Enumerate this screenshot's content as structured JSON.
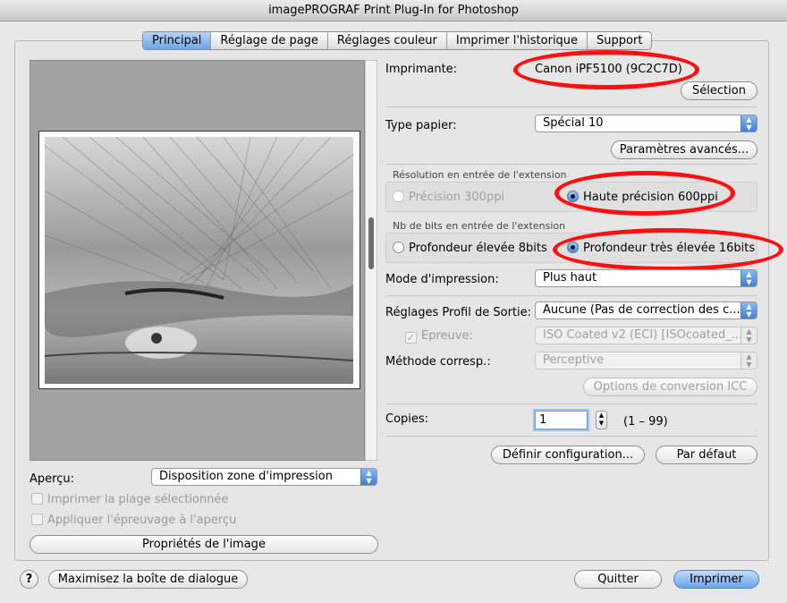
{
  "window": {
    "title": "imagePROGRAF Print Plug-In for Photoshop"
  },
  "tabs": [
    {
      "label": "Principal",
      "active": true
    },
    {
      "label": "Réglage de page",
      "active": false
    },
    {
      "label": "Réglages couleur",
      "active": false
    },
    {
      "label": "Imprimer l'historique",
      "active": false
    },
    {
      "label": "Support",
      "active": false
    }
  ],
  "printer": {
    "label": "Imprimante:",
    "value": "Canon iPF5100 (9C2C7D)",
    "select_button": "Sélection"
  },
  "paper": {
    "label": "Type papier:",
    "value": "Spécial 10",
    "advanced_button": "Paramètres avancés..."
  },
  "resolution": {
    "group_label": "Résolution en entrée de l'extension",
    "option1": "Précision 300ppi",
    "option2": "Haute précision 600ppi",
    "selected": "option2"
  },
  "bits": {
    "group_label": "Nb de bits en entrée de l'extension",
    "option1": "Profondeur élevée 8bits",
    "option2": "Profondeur très élevée 16bits",
    "selected": "option2"
  },
  "print_mode": {
    "label": "Mode d'impression:",
    "value": "Plus haut"
  },
  "output_profile": {
    "label": "Réglages Profil de Sortie:",
    "value": "Aucune (Pas de correction des c..."
  },
  "proof": {
    "label": "Epreuve:",
    "checked": true,
    "value": "ISO Coated v2 (ECI)  [ISOcoated_..."
  },
  "matching": {
    "label": "Méthode corresp.:",
    "value": "Perceptive"
  },
  "icc_button": "Options de conversion ICC",
  "copies": {
    "label": "Copies:",
    "value": "1",
    "range": "(1 – 99)"
  },
  "config_button": "Définir configuration...",
  "default_button": "Par défaut",
  "preview": {
    "label": "Aperçu:",
    "value": "Disposition zone d'impression",
    "check1": "Imprimer la plage sélectionnée",
    "check2": "Appliquer l'épreuvage à l'aperçu",
    "props_button": "Propriétés de l'image"
  },
  "footer": {
    "help_glyph": "?",
    "maximize_button": "Maximisez la boîte de dialogue",
    "quit_button": "Quitter",
    "print_button": "Imprimer"
  },
  "colors": {
    "annotation_red": "#ff1010",
    "accent_blue": "#6aa3ea"
  }
}
